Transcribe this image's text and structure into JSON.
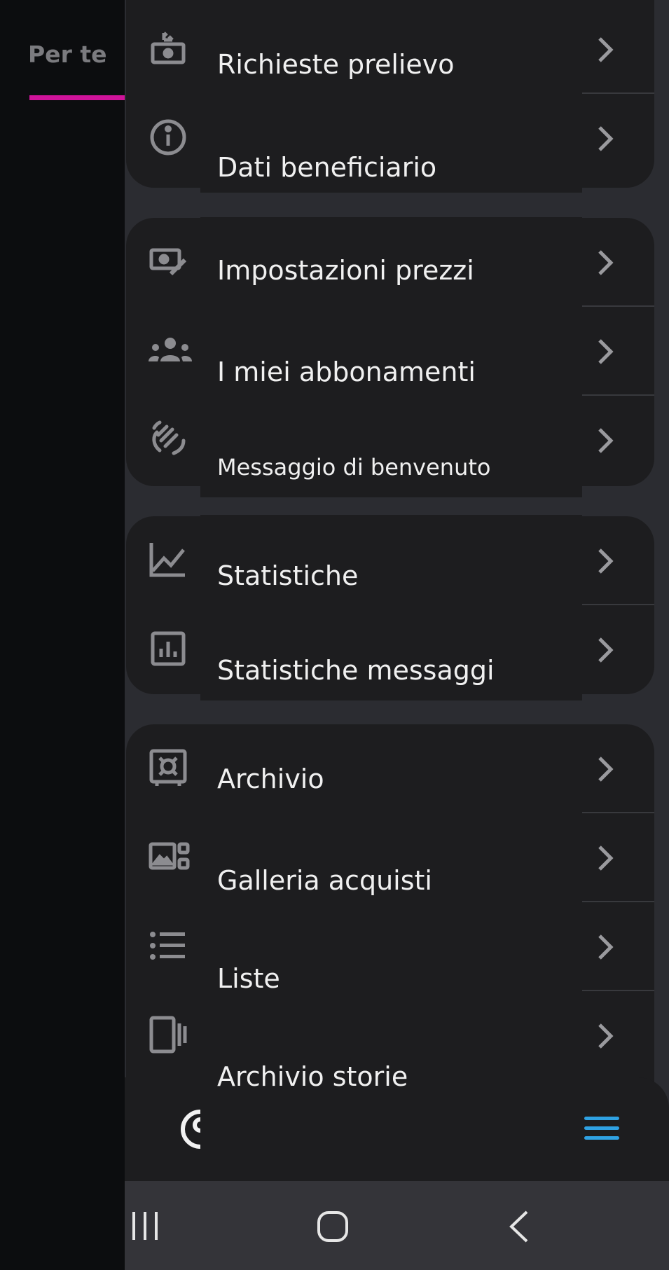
{
  "background_tab": {
    "label": "Per te",
    "underline_color": "#d0139a"
  },
  "menu_groups": [
    {
      "items": [
        {
          "label": "Richieste prelievo",
          "icon": "withdraw-cash-icon"
        },
        {
          "label": "Dati beneficiario",
          "icon": "info-icon"
        }
      ]
    },
    {
      "items": [
        {
          "label": "Impostazioni prezzi",
          "icon": "price-edit-icon"
        },
        {
          "label": "I miei abbonamenti",
          "icon": "group-icon"
        },
        {
          "label": "Messaggio di benvenuto",
          "icon": "waving-hand-icon"
        }
      ]
    },
    {
      "items": [
        {
          "label": "Statistiche",
          "icon": "line-chart-icon"
        },
        {
          "label": "Statistiche messaggi",
          "icon": "bar-chart-icon"
        }
      ]
    },
    {
      "items": [
        {
          "label": "Archivio",
          "icon": "vault-icon"
        },
        {
          "label": "Galleria acquisti",
          "icon": "gallery-icon"
        },
        {
          "label": "Liste",
          "icon": "list-icon"
        },
        {
          "label": "Archivio storie",
          "icon": "stories-icon"
        }
      ]
    }
  ],
  "bottom_bar": {
    "left_icon": "profile-icon",
    "right_icon": "menu-icon",
    "accent_color": "#2fa2e3"
  },
  "system_nav": {
    "recent": "recent-apps-icon",
    "home": "home-icon",
    "back": "back-icon"
  }
}
